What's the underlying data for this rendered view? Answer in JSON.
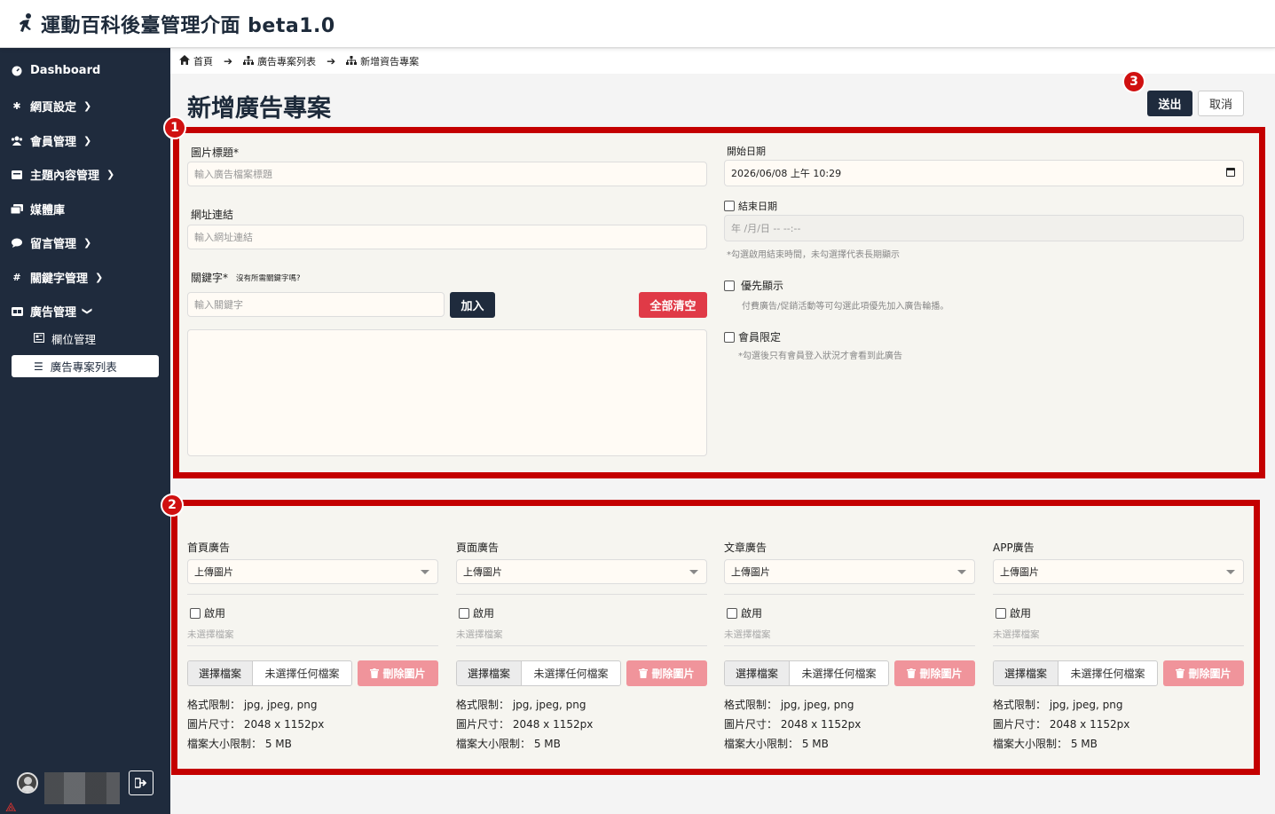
{
  "app": {
    "title": "運動百科後臺管理介面 beta1.0",
    "icon": "running-person-icon"
  },
  "sidebar": {
    "items": [
      {
        "label": "Dashboard",
        "icon": "dashboard-icon"
      },
      {
        "label": "網頁設定",
        "icon": "gear-icon"
      },
      {
        "label": "會員管理",
        "icon": "users-icon"
      },
      {
        "label": "主題內容管理",
        "icon": "folder-icon"
      },
      {
        "label": "媒體庫",
        "icon": "images-icon"
      },
      {
        "label": "留言管理",
        "icon": "comment-icon"
      },
      {
        "label": "關鍵字管理",
        "icon": "hashtag-icon"
      },
      {
        "label": "廣告管理",
        "icon": "ad-icon"
      }
    ],
    "sub_items": [
      {
        "label": "欄位管理",
        "icon": "layout-icon"
      },
      {
        "label": "廣告專案列表",
        "icon": "list-icon",
        "active": true
      }
    ]
  },
  "breadcrumb": [
    "首頁",
    "廣告專案列表",
    "新增資告專案"
  ],
  "page": {
    "title": "新增廣告專案",
    "submit": "送出",
    "cancel": "取消"
  },
  "badges": [
    "1",
    "2",
    "3"
  ],
  "form": {
    "image_title": {
      "label": "圖片標題*",
      "placeholder": "輸入廣告檔案標題"
    },
    "url": {
      "label": "網址連結",
      "placeholder": "輸入網址連結"
    },
    "keyword": {
      "label": "關鍵字*",
      "hint": "沒有所需關鍵字嗎?",
      "placeholder": "輸入關鍵字",
      "add": "加入",
      "clear": "全部清空"
    },
    "start_date": {
      "label": "開始日期",
      "value": "2026/06/08 上午 10:29"
    },
    "end_date": {
      "label": "結束日期",
      "placeholder": "年 /月/日 -- --:--",
      "hint": "*勾選啟用結束時間，未勾選擇代表長期顯示"
    },
    "priority": {
      "label": "優先顯示",
      "hint": "付費廣告/促銷活動等可勾選此項優先加入廣告輪播。"
    },
    "members_only": {
      "label": "會員限定",
      "hint": "*勾選後只有會員登入狀況才會看到此廣告"
    }
  },
  "ads": {
    "upload_option": "上傳圖片",
    "enable": "啟用",
    "no_file": "未選擇檔案",
    "pick_file": "選擇檔案",
    "none_chosen": "未選擇任何檔案",
    "delete": "刪除圖片",
    "format": "格式限制： jpg, jpeg, png",
    "size": "圖片尺寸： 2048 x 1152px",
    "filesize": "檔案大小限制： 5 MB",
    "columns": [
      "首頁廣告",
      "頁面廣告",
      "文章廣告",
      "APP廣告"
    ]
  },
  "colors": {
    "sidebar": "#1f2b3d",
    "highlight": "#c40000",
    "danger": "#e03a47",
    "danger_light": "#f0949b"
  }
}
